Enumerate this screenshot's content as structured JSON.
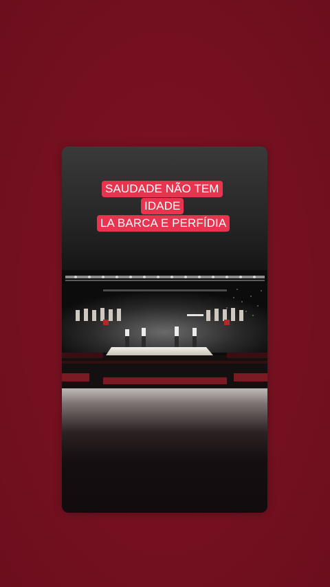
{
  "story": {
    "caption_lines": [
      "SAUDADE NÃO TEM",
      "IDADE",
      "LA BARCA E PERFÍDIA"
    ]
  },
  "colors": {
    "background": "#7a1222",
    "caption_bg": "#e8344f",
    "caption_text": "#ffffff"
  },
  "media": {
    "scene": "concert-stage-video"
  }
}
